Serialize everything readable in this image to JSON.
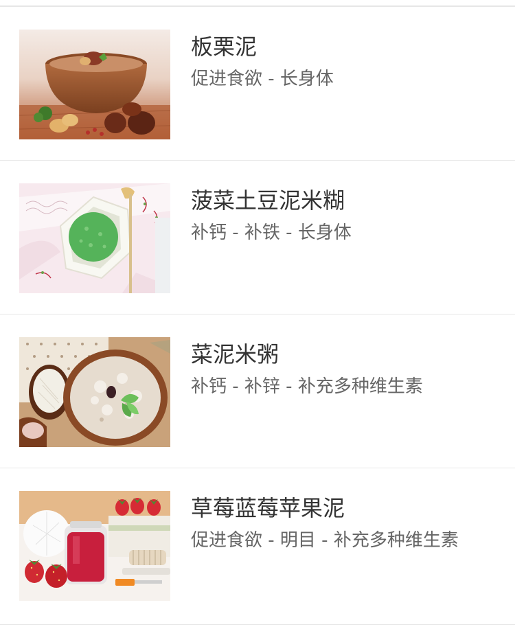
{
  "items": [
    {
      "title": "板栗泥",
      "tags": "促进食欲 - 长身体",
      "image_alt": "chestnut-puree-photo"
    },
    {
      "title": "菠菜土豆泥米糊",
      "tags": "补钙 - 补铁 - 长身体",
      "image_alt": "spinach-potato-rice-paste-photo"
    },
    {
      "title": "菜泥米粥",
      "tags": "补钙 - 补锌 - 补充多种维生素",
      "image_alt": "vegetable-rice-porridge-photo"
    },
    {
      "title": "草莓蓝莓苹果泥",
      "tags": "促进食欲 - 明目 - 补充多种维生素",
      "image_alt": "strawberry-blueberry-apple-puree-photo"
    }
  ],
  "colors": {
    "title": "#333333",
    "tags": "#666666",
    "divider": "#e8e8e8"
  }
}
